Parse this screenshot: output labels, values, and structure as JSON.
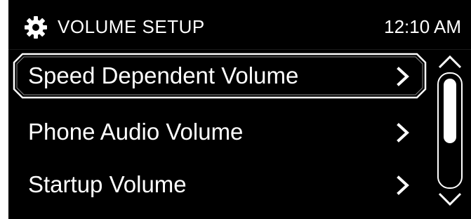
{
  "header": {
    "title": "VOLUME SETUP",
    "time": "12:10 AM",
    "icon": "gear-icon"
  },
  "menu": {
    "items": [
      {
        "label": "Speed Dependent Volume",
        "selected": true
      },
      {
        "label": "Phone Audio Volume",
        "selected": false
      },
      {
        "label": "Startup Volume",
        "selected": false
      }
    ]
  },
  "scrollbar": {
    "up_icon": "chevron-up-icon",
    "down_icon": "chevron-down-icon"
  },
  "colors": {
    "background": "#000000",
    "text": "#ffffff",
    "frame": "#ffffff"
  }
}
